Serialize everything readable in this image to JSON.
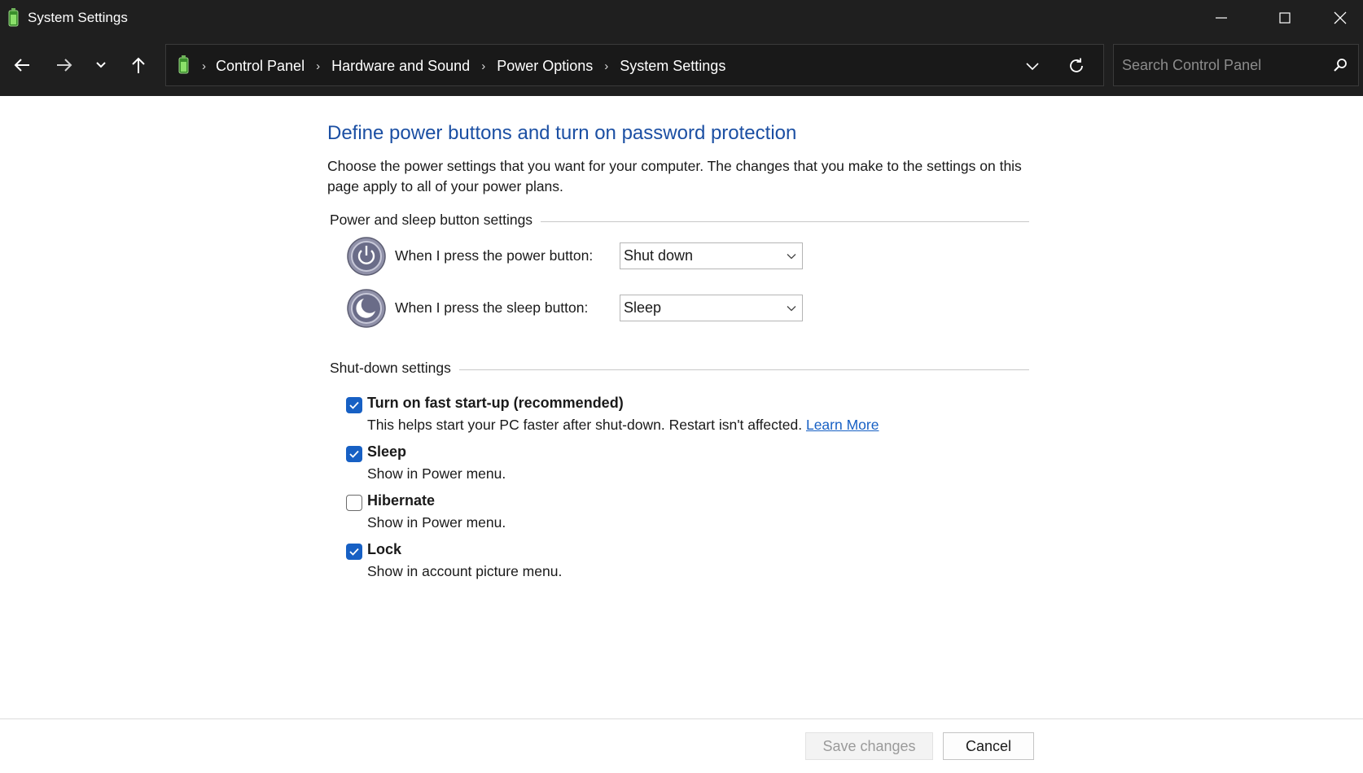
{
  "window": {
    "title": "System Settings",
    "minimize_icon": "minimize-icon",
    "maximize_icon": "maximize-icon",
    "close_icon": "close-icon"
  },
  "nav": {
    "back_icon": "arrow-left-icon",
    "forward_icon": "arrow-right-icon",
    "recent_icon": "chevron-down-icon",
    "up_icon": "arrow-up-icon"
  },
  "address": {
    "crumbs": [
      "Control Panel",
      "Hardware and Sound",
      "Power Options",
      "System Settings"
    ],
    "dropdown_icon": "chevron-down-icon",
    "refresh_icon": "refresh-icon"
  },
  "search": {
    "placeholder": "Search Control Panel",
    "icon": "search-icon"
  },
  "main": {
    "heading": "Define power buttons and turn on password protection",
    "description": "Choose the power settings that you want for your computer. The changes that you make to the settings on this page apply to all of your power plans.",
    "power_group_label": "Power and sleep button settings",
    "power_button_label": "When I press the power button:",
    "power_button_value": "Shut down",
    "sleep_button_label": "When I press the sleep button:",
    "sleep_button_value": "Sleep",
    "shutdown_group_label": "Shut-down settings",
    "options": [
      {
        "title": "Turn on fast start-up (recommended)",
        "subtitle": "This helps start your PC faster after shut-down. Restart isn't affected.",
        "link": "Learn More",
        "checked": true
      },
      {
        "title": "Sleep",
        "subtitle": "Show in Power menu.",
        "checked": true
      },
      {
        "title": "Hibernate",
        "subtitle": "Show in Power menu.",
        "checked": false
      },
      {
        "title": "Lock",
        "subtitle": "Show in account picture menu.",
        "checked": true
      }
    ]
  },
  "footer": {
    "save_label": "Save changes",
    "cancel_label": "Cancel"
  },
  "colors": {
    "accent": "#1760c4",
    "heading": "#1b4fa3",
    "titlebar": "#1f1f1f"
  }
}
